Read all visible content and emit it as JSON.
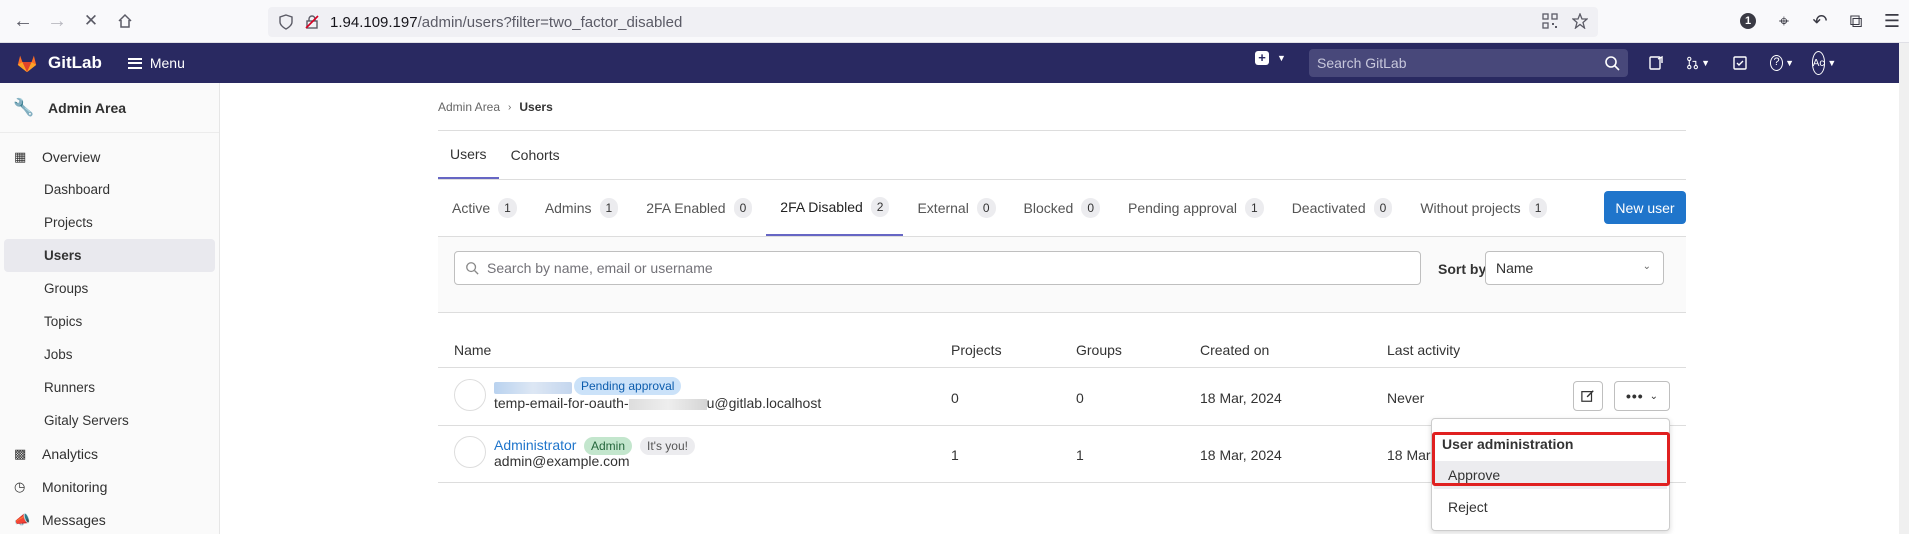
{
  "browser": {
    "url_host": "1.94.109.197",
    "url_path": "/admin/users?filter=two_factor_disabled"
  },
  "header": {
    "brand": "GitLab",
    "menu_label": "Menu",
    "search_placeholder": "Search GitLab",
    "avatar_initials": "Ac",
    "bg_color": "#292961"
  },
  "sidebar": {
    "title": "Admin Area",
    "overview_label": "Overview",
    "overview_items": [
      "Dashboard",
      "Projects",
      "Users",
      "Groups",
      "Topics",
      "Jobs",
      "Runners",
      "Gitaly Servers"
    ],
    "active_item": "Users",
    "analytics_label": "Analytics",
    "monitoring_label": "Monitoring",
    "messages_label": "Messages"
  },
  "breadcrumb": {
    "root": "Admin Area",
    "current": "Users"
  },
  "page_tabs": [
    {
      "label": "Users",
      "active": true
    },
    {
      "label": "Cohorts",
      "active": false
    }
  ],
  "filter_tabs": [
    {
      "label": "Active",
      "count": "1"
    },
    {
      "label": "Admins",
      "count": "1"
    },
    {
      "label": "2FA Enabled",
      "count": "0"
    },
    {
      "label": "2FA Disabled",
      "count": "2",
      "active": true
    },
    {
      "label": "External",
      "count": "0"
    },
    {
      "label": "Blocked",
      "count": "0"
    },
    {
      "label": "Pending approval",
      "count": "1"
    },
    {
      "label": "Deactivated",
      "count": "0"
    },
    {
      "label": "Without projects",
      "count": "1"
    }
  ],
  "new_user_label": "New user",
  "search": {
    "placeholder": "Search by name, email or username"
  },
  "sort": {
    "label": "Sort by",
    "selected": "Name"
  },
  "table": {
    "headers": [
      "Name",
      "Projects",
      "Groups",
      "Created on",
      "Last activity"
    ],
    "rows": [
      {
        "badge": "Pending approval",
        "email_prefix": "temp-email-for-oauth-",
        "email_suffix": "u@gitlab.localhost",
        "projects": "0",
        "groups": "0",
        "created": "18 Mar, 2024",
        "last_activity": "Never"
      },
      {
        "name": "Administrator",
        "badge": "Admin",
        "badge2": "It's you!",
        "email": "admin@example.com",
        "projects": "1",
        "groups": "1",
        "created": "18 Mar, 2024",
        "last_activity": "18 Mar"
      }
    ]
  },
  "dropdown": {
    "title": "User administration",
    "items": [
      "Approve",
      "Reject"
    ]
  }
}
